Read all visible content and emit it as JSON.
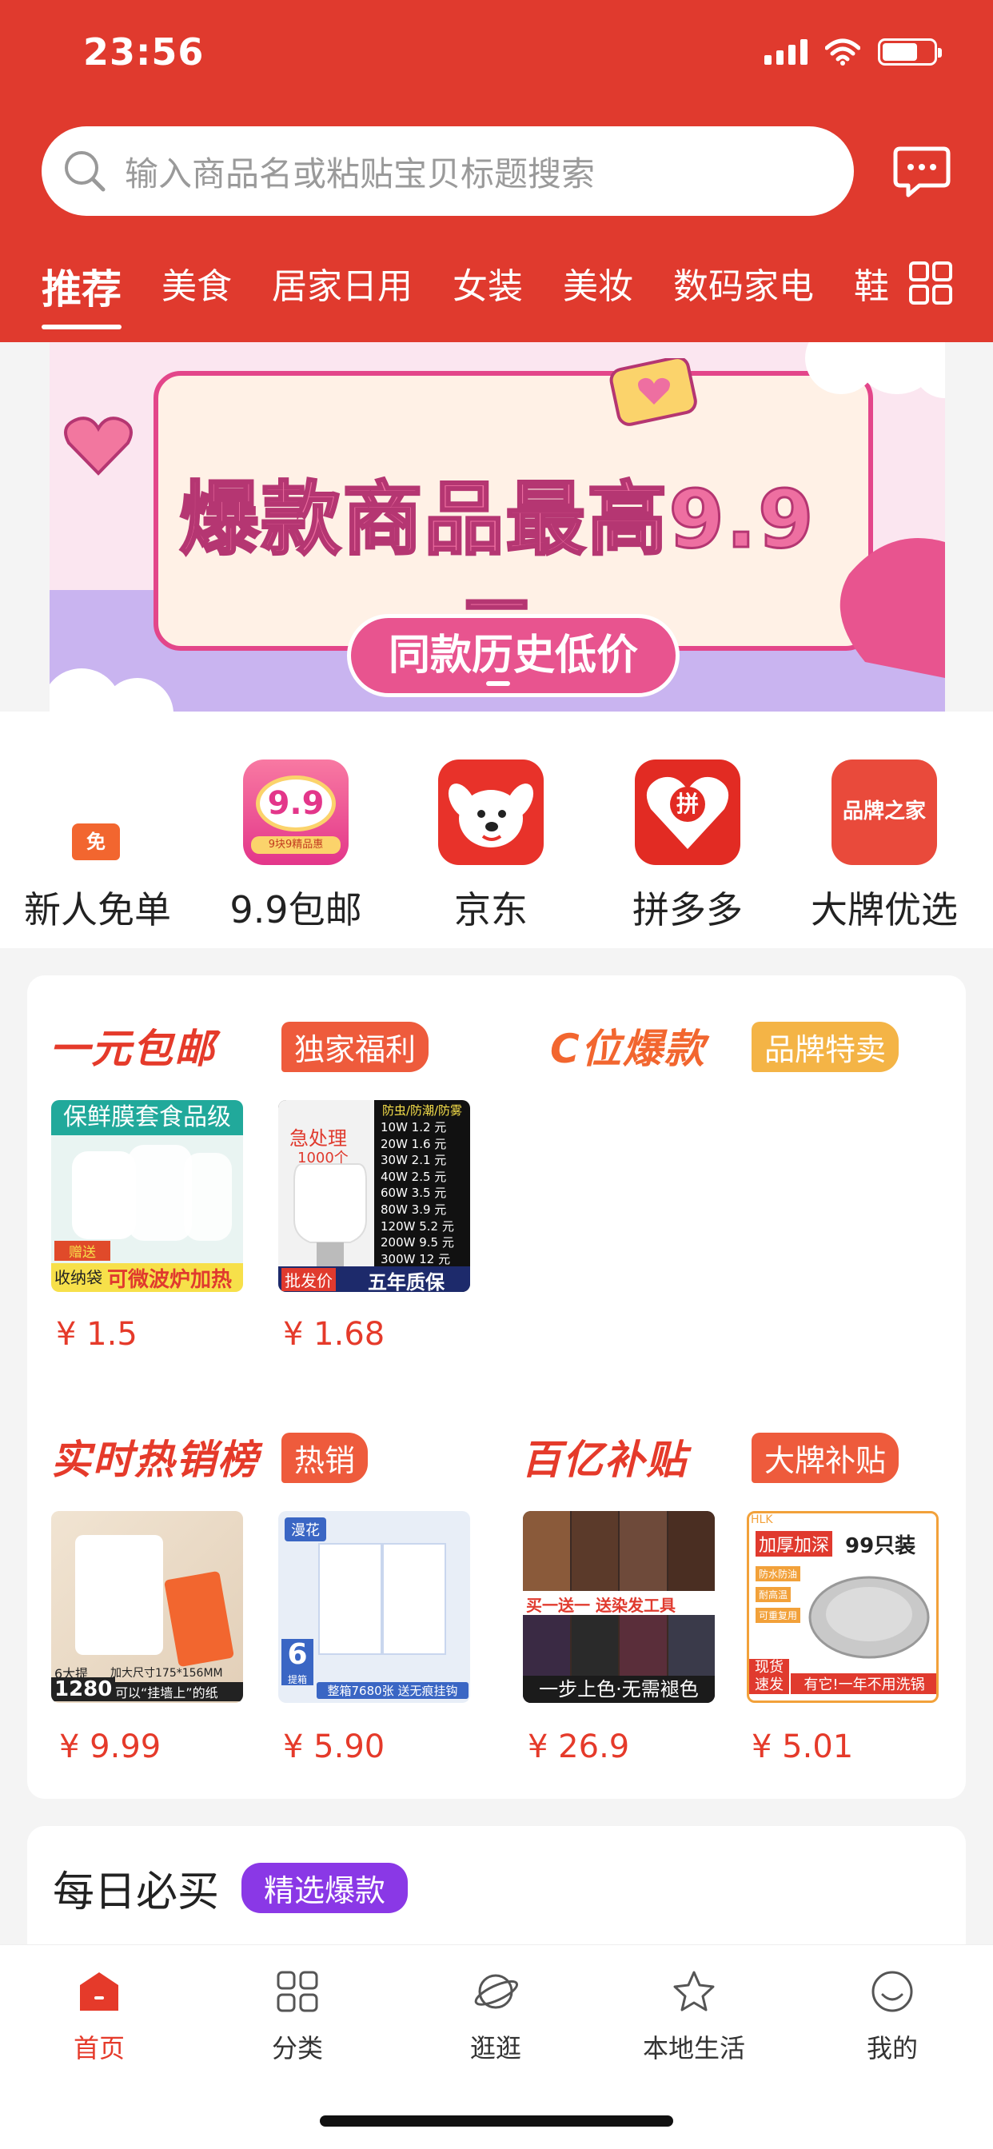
{
  "status_bar": {
    "time": "23:56"
  },
  "search": {
    "placeholder": "输入商品名或粘贴宝贝标题搜索"
  },
  "tabs": [
    "推荐",
    "美食",
    "居家日用",
    "女装",
    "美妆",
    "数码家电",
    "鞋"
  ],
  "banner": {
    "title": "爆款商品最高9.9元",
    "button": "同款历史低价"
  },
  "quick_links": [
    {
      "label": "新人免单",
      "badge": "免"
    },
    {
      "label": "9.9包邮",
      "icon_text": "9.9",
      "icon_sub": "9块9精品惠"
    },
    {
      "label": "京东"
    },
    {
      "label": "拼多多",
      "icon_text": "拼"
    },
    {
      "label": "大牌优选",
      "icon_text": "品牌之家"
    }
  ],
  "sections": [
    {
      "title": "一元包邮",
      "badge": "独家福利"
    },
    {
      "title": "C位爆款",
      "badge": "品牌特卖"
    },
    {
      "title": "实时热销榜",
      "badge": "热销"
    },
    {
      "title": "百亿补贴",
      "badge": "大牌补贴"
    }
  ],
  "products": {
    "p1": {
      "price": "¥ 1.5",
      "top": "保鲜膜套食品级",
      "l1": "赠送",
      "l2": "收纳袋",
      "bottom": "可微波炉加热"
    },
    "p2": {
      "price": "¥ 1.68",
      "label1": "急处理",
      "label2": "1000个",
      "header": "防虫/防潮/防雾",
      "rows": [
        "10W 1.2 元",
        "20W 1.6 元",
        "30W 2.1 元",
        "40W 2.5 元",
        "60W 3.5 元",
        "80W 3.9 元",
        "120W 5.2 元",
        "200W 9.5 元",
        "300W 12 元"
      ],
      "tag1": "批发价",
      "tag2": "五年质保"
    },
    "p3": {
      "price": "¥ 9.99",
      "count": "6大提",
      "big": "1280",
      "sub1": "加大尺寸175*156MM",
      "sub2": "可以“挂墙上”的纸"
    },
    "p4": {
      "price": "¥ 5.90",
      "brand": "漫花",
      "num": "6",
      "unit": "提箱",
      "bottom": "整箱7680张 送无痕挂钩"
    },
    "p5": {
      "price": "¥ 26.9",
      "mid": "买一送一 送染发工具",
      "bottom": "一步上色·无需褪色"
    },
    "p6": {
      "price": "¥ 5.01",
      "brand": "HLK",
      "top1": "加厚加深",
      "top2": "99只装",
      "f1": "防水防油",
      "f2": "耐高温",
      "f3": "可重复用",
      "tag": "现货速发",
      "bottom": "有它!一年不用洗锅"
    }
  },
  "daily": {
    "title": "每日必买",
    "badge": "精选爆款"
  },
  "nav": [
    "首页",
    "分类",
    "逛逛",
    "本地生活",
    "我的"
  ],
  "colors": {
    "brand": "#e03a2e",
    "price": "#e53a2a",
    "purple": "#8a38e6"
  }
}
